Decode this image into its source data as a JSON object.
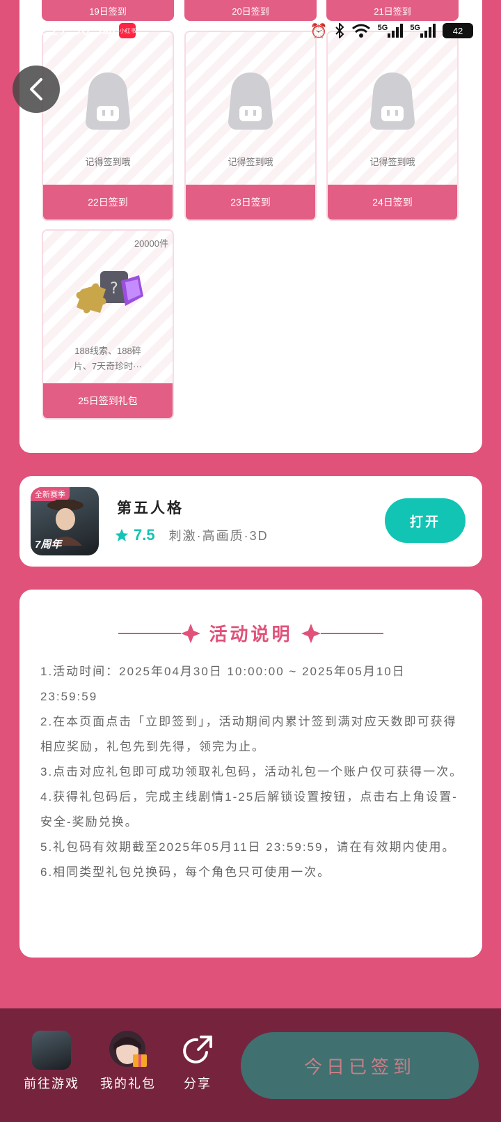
{
  "top_row": [
    "19日签到",
    "20日签到",
    "21日签到"
  ],
  "status": {
    "time": "02:27:56",
    "app1": "Tap",
    "app2": "小红书",
    "net1": "5G",
    "net2": "5G",
    "battery": "42"
  },
  "days": [
    {
      "label": "22日签到",
      "hint": "记得签到哦"
    },
    {
      "label": "23日签到",
      "hint": "记得签到哦"
    },
    {
      "label": "24日签到",
      "hint": "记得签到哦"
    }
  ],
  "gift": {
    "count": "20000件",
    "desc_line1": "188线索、188碎",
    "desc_line2": "片、7天奇珍时···",
    "label": "25日签到礼包"
  },
  "game": {
    "name": "第五人格",
    "rating": "7.5",
    "tags": "刺激·高画质·3D",
    "open_label": "打开",
    "icon_badge": "全新赛季",
    "icon_anniv": "7周年"
  },
  "description": {
    "title": "活动说明",
    "items": [
      "1.活动时间：2025年04月30日 10:00:00 ~ 2025年05月10日 23:59:59",
      "2.在本页面点击「立即签到」，活动期间内累计签到满对应天数即可获得相应奖励，礼包先到先得，领完为止。",
      "3.点击对应礼包即可成功领取礼包码，活动礼包一个账户仅可获得一次。",
      "4.获得礼包码后，完成主线剧情1-25后解锁设置按钮，点击右上角设置-安全-奖励兑换。",
      "5.礼包码有效期截至2025年05月11日 23:59:59，请在有效期内使用。",
      "6.相同类型礼包兑换码，每个角色只可使用一次。"
    ]
  },
  "bottom": {
    "goto_game": "前往游戏",
    "my_gifts": "我的礼包",
    "share": "分享",
    "signed": "今日已签到"
  },
  "colors": {
    "background": "#e0527a",
    "day_label": "#e35e84",
    "accent_teal": "#12c4b4",
    "bottom_bar": "#76243e",
    "signed_button": "#407070"
  }
}
